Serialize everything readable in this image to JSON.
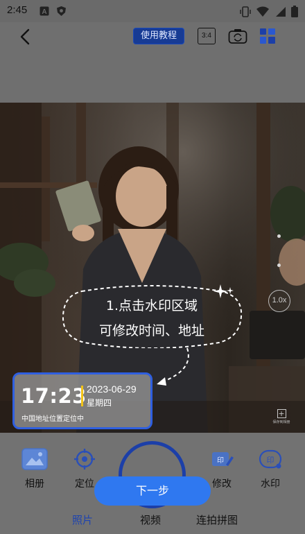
{
  "status_bar": {
    "time": "2:45",
    "left_icons": [
      "font-a-icon",
      "shield-icon"
    ],
    "right_icons": [
      "vibrate-icon",
      "wifi-icon",
      "signal-icon",
      "battery-icon"
    ]
  },
  "top_bar": {
    "tutorial_label": "使用教程",
    "ratio_label": "3:4",
    "icons": [
      "back-arrow-icon",
      "flip-camera-icon",
      "grid-menu-icon"
    ]
  },
  "preview": {
    "zoom_label": "1.0x",
    "hint": {
      "line1": "1.点击水印区域",
      "line2": "可修改时间、地址"
    },
    "watermark": {
      "time": "17:23",
      "date": "2023-06-29",
      "weekday": "星期四",
      "location": "中国地址位置定位中"
    },
    "save_album_label": "保存到相册"
  },
  "tools": [
    {
      "label": "相册",
      "icon": "album-icon"
    },
    {
      "label": "定位",
      "icon": "location-icon"
    },
    {
      "label": "修改",
      "icon": "edit-icon"
    },
    {
      "label": "水印",
      "icon": "watermark-icon"
    }
  ],
  "next_label": "下一步",
  "modes": [
    {
      "label": "照片",
      "active": true
    },
    {
      "label": "视频",
      "active": false
    },
    {
      "label": "连拍拼图",
      "active": false
    }
  ],
  "colors": {
    "accent": "#2f78f0",
    "watermark_border": "#2f5fe0",
    "time_bar": "#f2c318",
    "active_tab": "#1d43b0"
  }
}
